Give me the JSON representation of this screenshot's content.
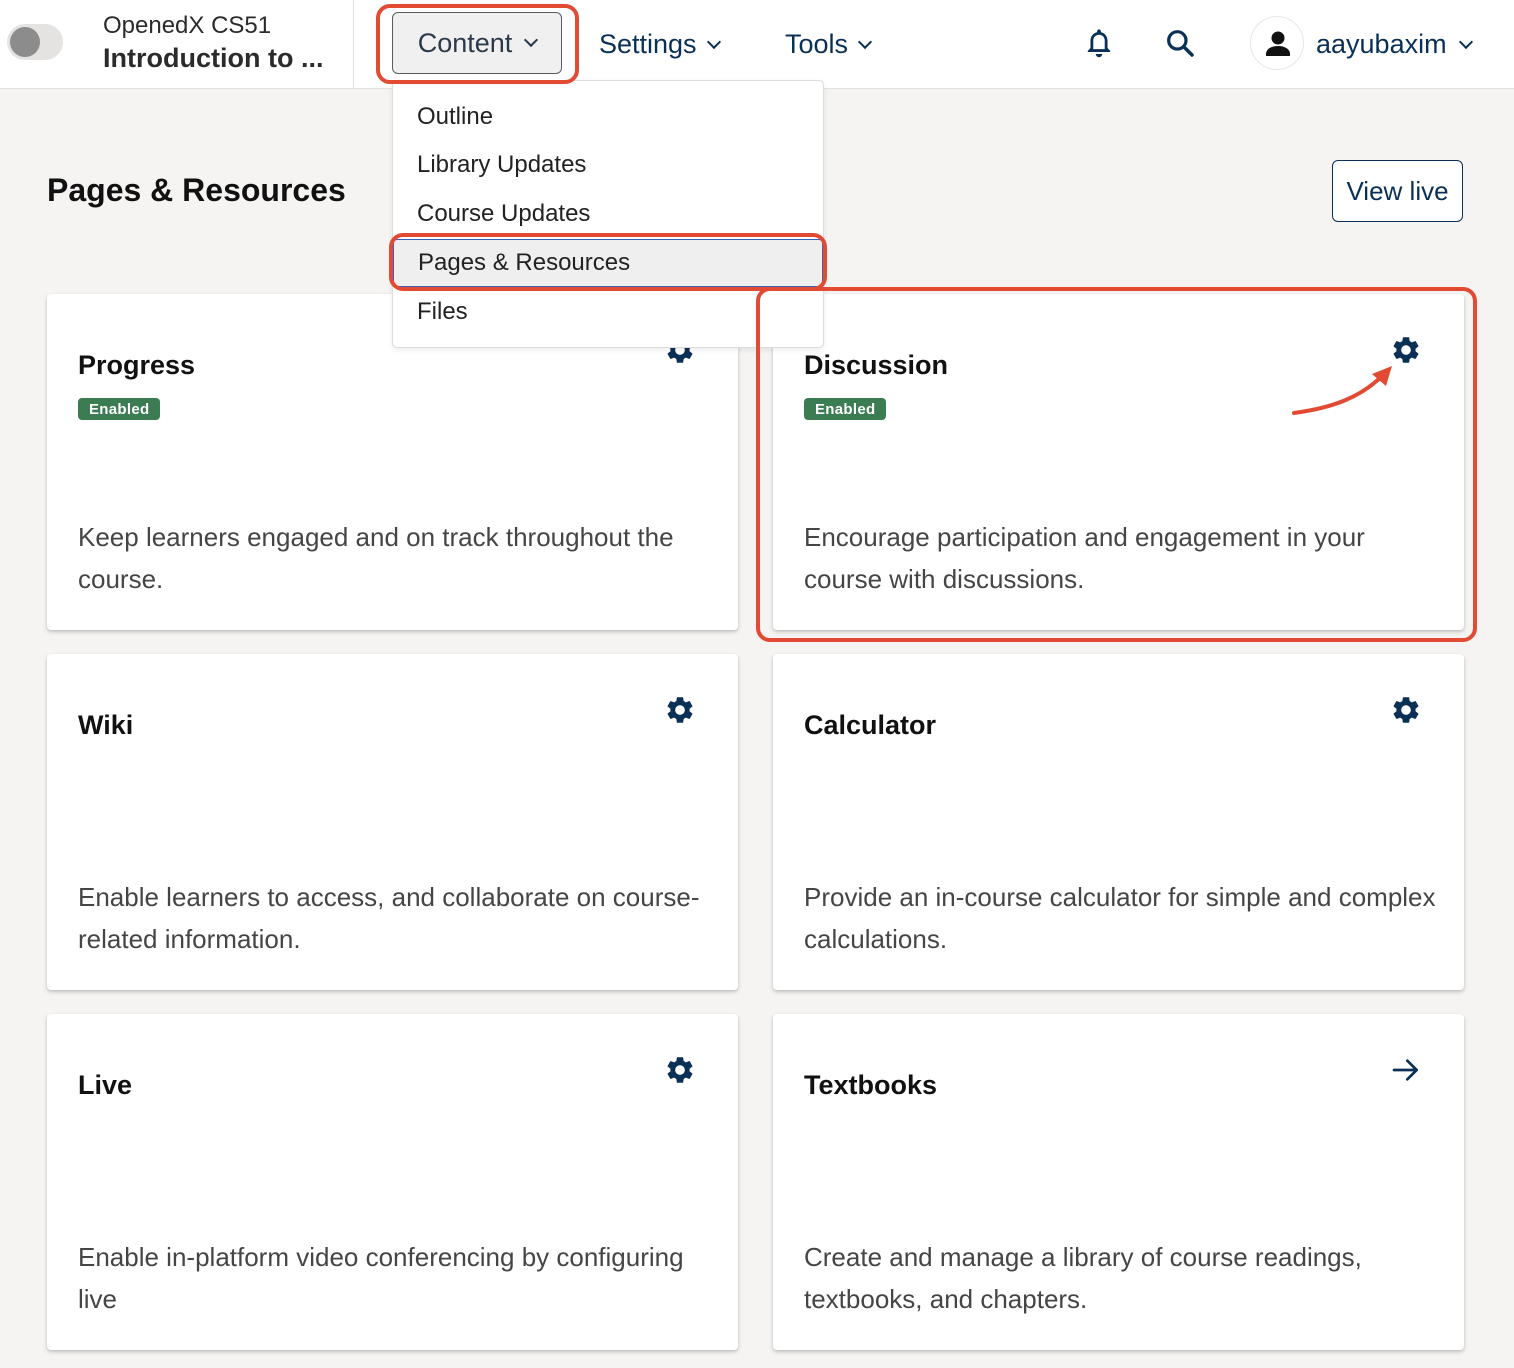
{
  "header": {
    "course_org": "OpenedX CS51",
    "course_title": "Introduction to ...",
    "nav": {
      "content": "Content",
      "settings": "Settings",
      "tools": "Tools"
    },
    "username": "aayubaxim",
    "icons": [
      "bell-icon",
      "search-icon",
      "user-icon"
    ]
  },
  "content_menu": {
    "items": [
      {
        "label": "Outline"
      },
      {
        "label": "Library Updates"
      },
      {
        "label": "Course Updates"
      },
      {
        "label": "Pages & Resources",
        "active": true
      },
      {
        "label": "Files"
      }
    ]
  },
  "page": {
    "title": "Pages & Resources",
    "view_live": "View live"
  },
  "cards": [
    {
      "title": "Progress",
      "badge": "Enabled",
      "description": "Keep learners engaged and on track throughout the course.",
      "icon": "gear-icon"
    },
    {
      "title": "Discussion",
      "badge": "Enabled",
      "description": "Encourage participation and engagement in your course with discussions.",
      "icon": "gear-icon"
    },
    {
      "title": "Wiki",
      "description": "Enable learners to access, and collaborate on course-related information.",
      "icon": "gear-icon"
    },
    {
      "title": "Calculator",
      "description": "Provide an in-course calculator for simple and complex calculations.",
      "icon": "gear-icon"
    },
    {
      "title": "Live",
      "description": "Enable in-platform video conferencing by configuring live",
      "icon": "gear-icon"
    },
    {
      "title": "Textbooks",
      "description": "Create and manage a library of course readings, textbooks, and chapters.",
      "icon": "arrow-right-icon"
    }
  ],
  "colors": {
    "brand_dark": "#0a3055",
    "enabled_badge": "#3b7c53",
    "highlight": "#e24a33",
    "background": "#f5f4f2"
  }
}
